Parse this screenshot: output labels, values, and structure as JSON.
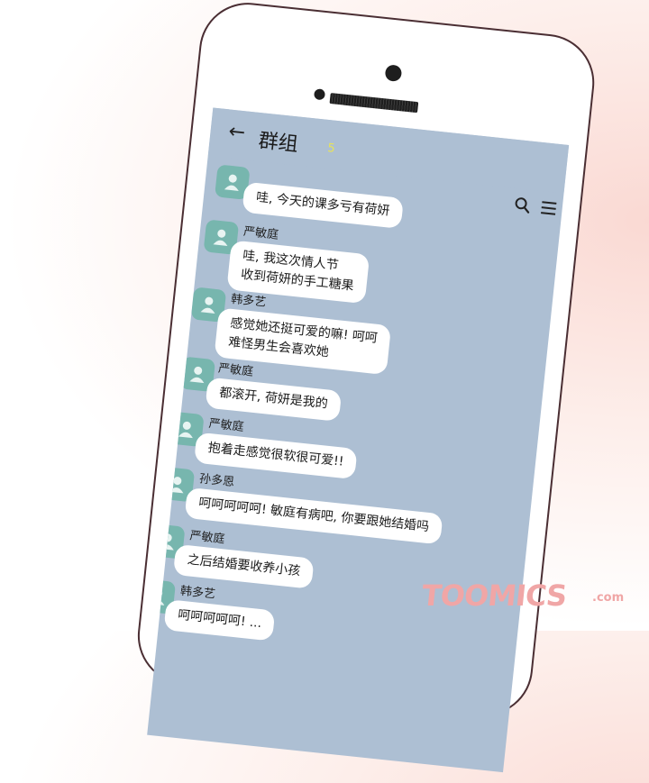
{
  "header": {
    "title": "群组",
    "member_count": "5"
  },
  "messages": [
    {
      "sender": "",
      "lines": [
        "哇, 今天的课多亏有荷妍"
      ]
    },
    {
      "sender": "严敏庭",
      "lines": [
        "哇, 我这次情人节",
        "收到荷妍的手工糖果"
      ]
    },
    {
      "sender": "韩多艺",
      "lines": [
        "感觉她还挺可爱的嘛! 呵呵",
        "难怪男生会喜欢她"
      ]
    },
    {
      "sender": "严敏庭",
      "lines": [
        "都滚开, 荷妍是我的"
      ]
    },
    {
      "sender": "严敏庭",
      "lines": [
        "抱着走感觉很软很可爱!!"
      ]
    },
    {
      "sender": "孙多恩",
      "lines": [
        "呵呵呵呵呵! 敏庭有病吧, 你要跟她结婚吗"
      ]
    },
    {
      "sender": "严敏庭",
      "lines": [
        "之后结婚要收养小孩"
      ]
    },
    {
      "sender": "韩多艺",
      "lines": [
        "呵呵呵呵呵! ..."
      ]
    }
  ],
  "icons": {
    "back": "arrow-left-icon",
    "search": "search-icon",
    "menu": "hamburger-menu-icon",
    "avatar": "person-icon"
  },
  "colors": {
    "screen_bg": "#adbfd3",
    "avatar": "#77b6ae",
    "bubble": "#ffffff",
    "count": "#e8e35a",
    "phone_border": "#4a2e33"
  },
  "watermark": {
    "brand": "TOOMICS",
    "suffix": ".com"
  }
}
